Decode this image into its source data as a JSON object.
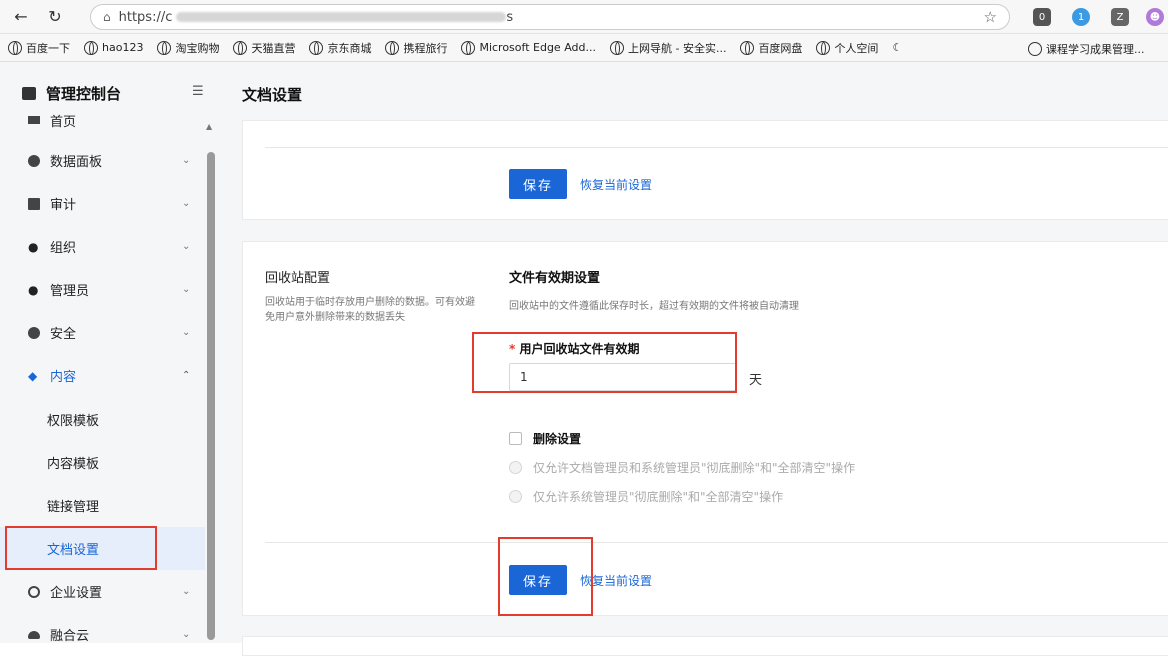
{
  "browser": {
    "url_prefix": "https://c",
    "url_suffix": "s",
    "bookmarks": [
      "百度一下",
      "hao123",
      "淘宝购物",
      "天猫直营",
      "京东商城",
      "携程旅行",
      "Microsoft Edge Add...",
      "上网导航 - 安全实...",
      "百度网盘",
      "个人空间"
    ],
    "bookmark_right": "课程学习成果管理...",
    "ext_badges": [
      "0",
      "1"
    ]
  },
  "sidebar": {
    "title": "管理控制台",
    "items": [
      {
        "label": "首页"
      },
      {
        "label": "数据面板"
      },
      {
        "label": "审计"
      },
      {
        "label": "组织"
      },
      {
        "label": "管理员"
      },
      {
        "label": "安全"
      },
      {
        "label": "内容"
      },
      {
        "label": "企业设置"
      },
      {
        "label": "融合云"
      }
    ],
    "sub_items": [
      {
        "label": "权限模板"
      },
      {
        "label": "内容模板"
      },
      {
        "label": "链接管理"
      },
      {
        "label": "文档设置"
      }
    ]
  },
  "main": {
    "title": "文档设置",
    "top_card": {
      "save_label": "保存",
      "restore_label": "恢复当前设置"
    },
    "recycle": {
      "title": "回收站配置",
      "desc": "回收站用于临时存放用户删除的数据。可有效避免用户意外删除带来的数据丢失",
      "section_title": "文件有效期设置",
      "section_hint": "回收站中的文件遵循此保存时长，超过有效期的文件将被自动清理",
      "field_required": "*",
      "field_label": "用户回收站文件有效期",
      "field_value": "1",
      "unit": "天",
      "delete_label": "删除设置",
      "radio1": "仅允许文档管理员和系统管理员\"彻底删除\"和\"全部清空\"操作",
      "radio2": "仅允许系统管理员\"彻底删除\"和\"全部清空\"操作",
      "save_label": "保存",
      "restore_label": "恢复当前设置"
    }
  }
}
